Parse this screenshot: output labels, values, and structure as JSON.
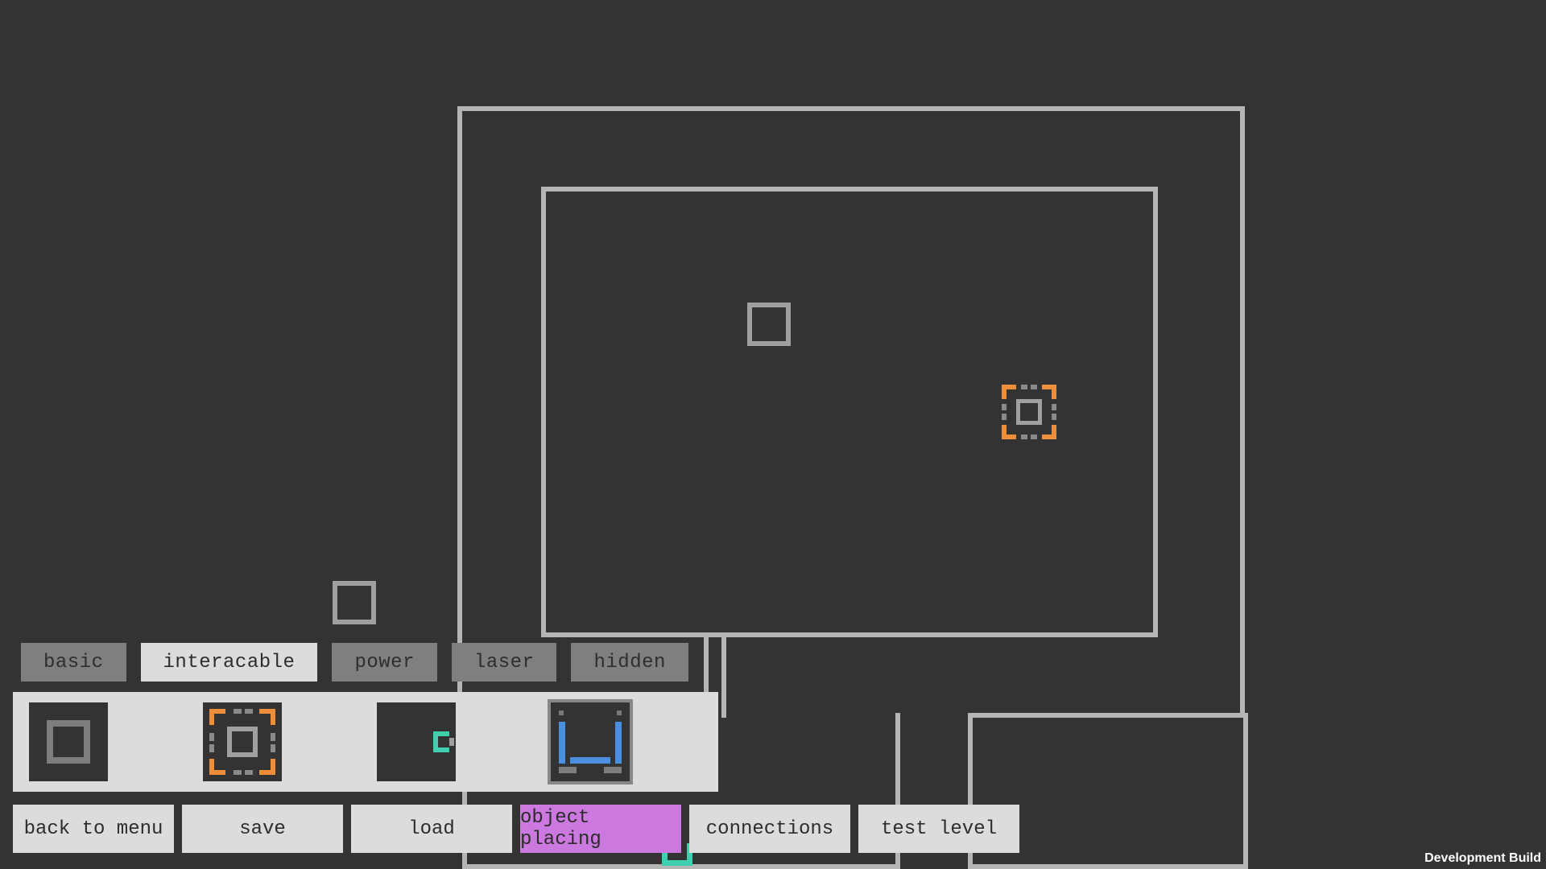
{
  "colors": {
    "bg": "#333333",
    "wall": "#b5b5b5",
    "tab_inactive_bg": "#7f7f7f",
    "tab_active_bg": "#dcdcdc",
    "action_bg": "#dcdcdc",
    "action_active_bg": "#cb79de",
    "accent_orange": "#ed8e3b",
    "accent_teal": "#3fd0b0",
    "accent_blue": "#4a8fe0"
  },
  "tabs": {
    "basic": "basic",
    "interacable": "interacable",
    "power": "power",
    "laser": "laser",
    "hidden": "hidden",
    "selected": "interacable"
  },
  "palette": {
    "items": [
      {
        "id": "box"
      },
      {
        "id": "goal"
      },
      {
        "id": "teal-half"
      },
      {
        "id": "blue-bucket"
      }
    ]
  },
  "actions": {
    "back": "back to menu",
    "save": "save",
    "load": "load",
    "object_placing": "object placing",
    "connections": "connections",
    "test_level": "test level",
    "selected": "object_placing"
  },
  "footer": {
    "dev_build": "Development Build"
  }
}
